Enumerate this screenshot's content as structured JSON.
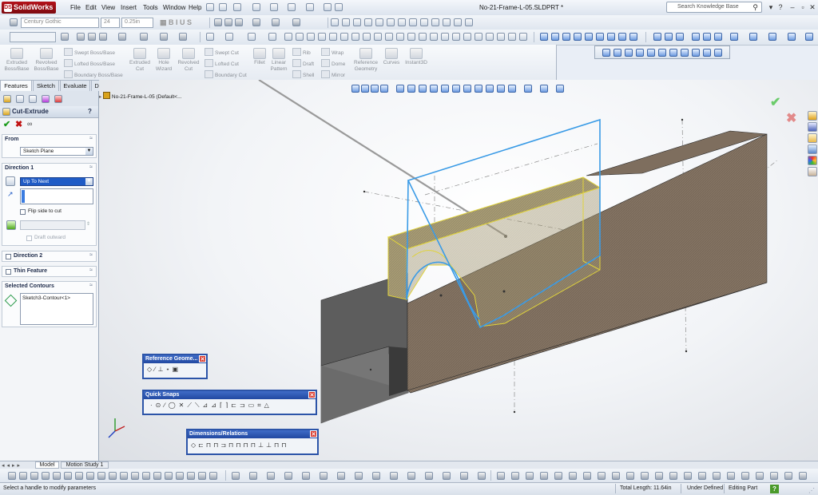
{
  "app": {
    "name": "SolidWorks",
    "document_title": "No-21-Frame-L-05.SLDPRT *"
  },
  "menu": [
    "File",
    "Edit",
    "View",
    "Insert",
    "Tools",
    "Window",
    "Help"
  ],
  "search": {
    "placeholder": "Search Knowledge Base"
  },
  "format_toolbar": {
    "font": "Century Gothic",
    "size": "24",
    "height": "0.25in"
  },
  "command_manager": {
    "items": [
      {
        "label": "Extruded Boss/Base"
      },
      {
        "label": "Revolved Boss/Base"
      },
      {
        "label": "Extruded Cut"
      },
      {
        "label": "Hole Wizard"
      },
      {
        "label": "Revolved Cut"
      },
      {
        "label": "Fillet"
      },
      {
        "label": "Linear Pattern"
      },
      {
        "label": "Reference Geometry"
      },
      {
        "label": "Curves"
      },
      {
        "label": "Instant3D"
      }
    ],
    "small_items": [
      "Swept Boss/Base",
      "Lofted Boss/Base",
      "Boundary Boss/Base",
      "Swept Cut",
      "Lofted Cut",
      "Boundary Cut",
      "Rib",
      "Draft",
      "Shell",
      "Wrap",
      "Dome",
      "Mirror"
    ]
  },
  "tabs": [
    "Features",
    "Sketch",
    "Evaluate",
    "DimXpert"
  ],
  "property_manager": {
    "title": "Cut-Extrude",
    "help": "?",
    "from": {
      "title": "From",
      "value": "Sketch Plane"
    },
    "direction1": {
      "title": "Direction 1",
      "end_condition": "Up To Next",
      "flip_label": "Flip side to cut",
      "draft_label": "Draft outward"
    },
    "direction2": {
      "title": "Direction 2"
    },
    "thin_feature": {
      "title": "Thin Feature"
    },
    "selected_contours": {
      "title": "Selected Contours",
      "item": "Sketch3-Contour<1>"
    }
  },
  "feature_tree": {
    "root": "No-21-Frame-L-05 (Default<..."
  },
  "floating_toolbars": {
    "reference_geometry": "Reference Geome...",
    "quick_snaps": "Quick Snaps",
    "dimensions_relations": "Dimensions/Relations"
  },
  "bottom_tabs": [
    "Model",
    "Motion Study 1"
  ],
  "status": {
    "message": "Select a handle to modify parameters",
    "total_length": "Total Length: 11.64in",
    "definition": "Under Defined",
    "mode": "Editing Part",
    "help": "?"
  },
  "colors": {
    "brand": "#b3121a",
    "highlight": "#3a7be0",
    "sketch": "#3a9be6",
    "preview": "#e0d33c"
  }
}
